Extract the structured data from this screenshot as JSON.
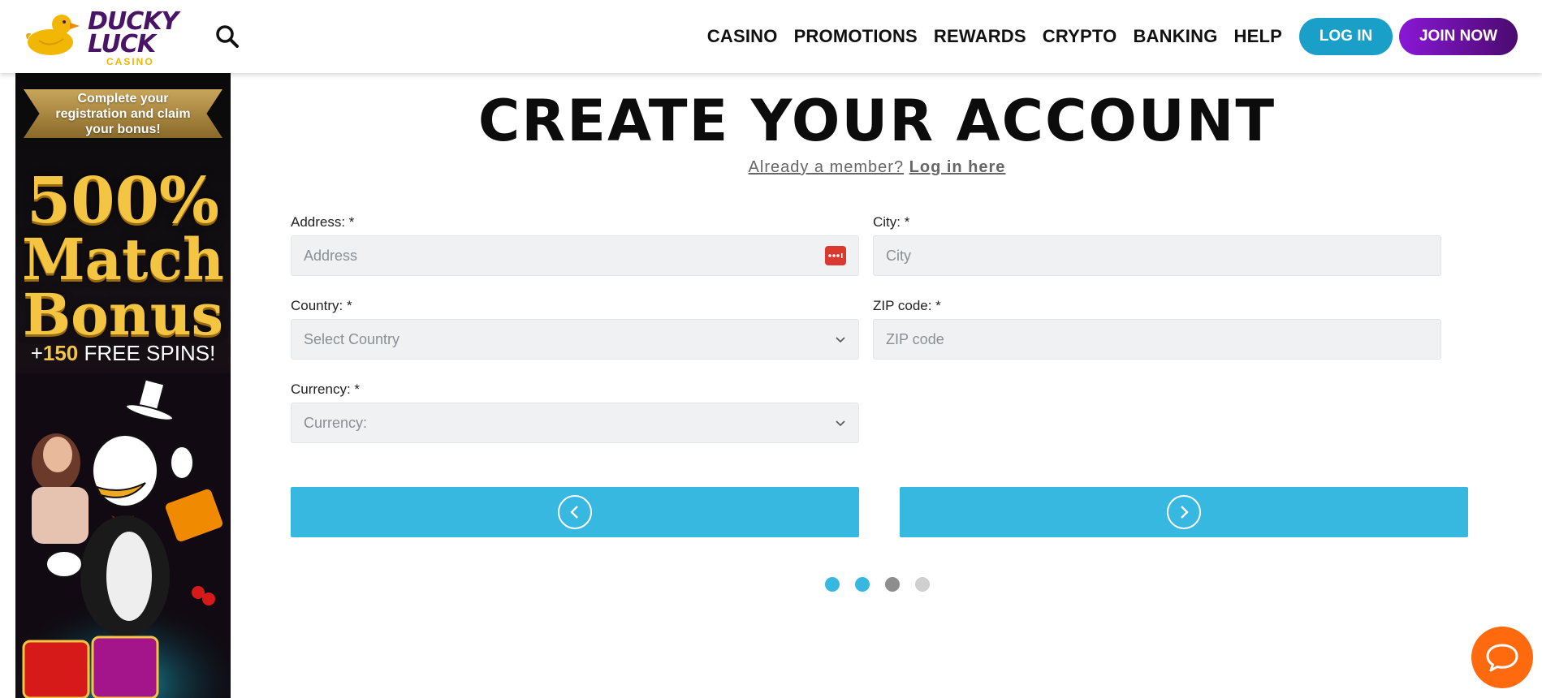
{
  "header": {
    "logo": {
      "line1": "DUCKY",
      "line2": "LUCK",
      "line3": "CASINO"
    },
    "nav": [
      "CASINO",
      "PROMOTIONS",
      "REWARDS",
      "CRYPTO",
      "BANKING",
      "HELP"
    ],
    "login_label": "LOG IN",
    "join_label": "JOIN NOW"
  },
  "banner": {
    "ribbon_text": "Complete your registration and claim your bonus!",
    "line1": "500%",
    "line2": "Match",
    "line3": "Bonus",
    "spins_prefix": "+",
    "spins_count": "150",
    "spins_suffix": " FREE SPINS!"
  },
  "form": {
    "title": "CREATE YOUR ACCOUNT",
    "member_text": "Already a member?",
    "member_link": "Log in here",
    "address": {
      "label": "Address: *",
      "placeholder": "Address"
    },
    "city": {
      "label": "City: *",
      "placeholder": "City"
    },
    "country": {
      "label": "Country: *",
      "selected": "Select Country"
    },
    "zip": {
      "label": "ZIP code: *",
      "placeholder": "ZIP code"
    },
    "currency": {
      "label": "Currency: *",
      "selected": "Currency:"
    }
  },
  "steps": {
    "total": 4,
    "colors": [
      "#37b8e0",
      "#37b8e0",
      "#8e8e8e",
      "#cfcfcf"
    ]
  },
  "colors": {
    "accent": "#37b8e0",
    "login": "#1aa0c8",
    "join_start": "#8a17d6",
    "join_end": "#4a0a6e",
    "chat": "#ff6a0e",
    "brand_purple": "#4a1466",
    "brand_gold": "#f2b705"
  }
}
